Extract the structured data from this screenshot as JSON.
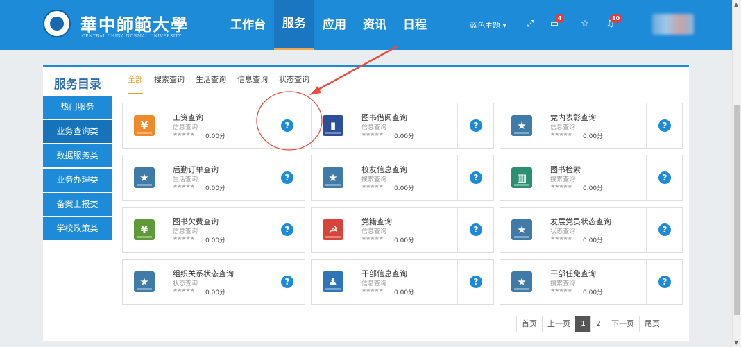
{
  "header": {
    "brand_cn": "華中師範大學",
    "brand_en": "CENTRAL CHINA NORMAL UNIVERSITY",
    "nav": [
      "工作台",
      "服务",
      "应用",
      "资讯",
      "日程"
    ],
    "active_nav": "服务",
    "theme_label": "蓝色主题 ▾",
    "message_badge": "4",
    "notification_badge": "10"
  },
  "panel": {
    "title": "服务目录",
    "tabs": [
      "全部",
      "搜索查询",
      "生活查询",
      "信息查询",
      "状态查询"
    ],
    "active_tab": "全部"
  },
  "sidebar": {
    "items": [
      "热门服务",
      "业务查询类",
      "数据服务类",
      "业务办理类",
      "备案上报类",
      "学校政策类"
    ],
    "active": "业务查询类"
  },
  "cards": [
    {
      "name": "工资查询",
      "category": "信息查询",
      "score": "0.00分",
      "icon": "salary-icon",
      "color": "#ee8a2a",
      "glyph": "¥"
    },
    {
      "name": "图书借阅查询",
      "category": "信息查询",
      "score": "0.00分",
      "icon": "book-icon",
      "color": "#2d4f9a",
      "glyph": "▮"
    },
    {
      "name": "党内表彰查询",
      "category": "信息查询",
      "score": "0.00分",
      "icon": "award-icon",
      "color": "#3f7ba6",
      "glyph": "★"
    },
    {
      "name": "后勤订单查询",
      "category": "生活查询",
      "score": "0.00分",
      "icon": "award-icon",
      "color": "#3f7ba6",
      "glyph": "★"
    },
    {
      "name": "校友信息查询",
      "category": "搜索查询",
      "score": "0.00分",
      "icon": "award-icon",
      "color": "#3f7ba6",
      "glyph": "★"
    },
    {
      "name": "图书检索",
      "category": "搜索查询",
      "score": "0.00分",
      "icon": "open-book-icon",
      "color": "#2b8f74",
      "glyph": "▥"
    },
    {
      "name": "图书欠费查询",
      "category": "信息查询",
      "score": "0.00分",
      "icon": "fee-icon",
      "color": "#5e9a3a",
      "glyph": "¥"
    },
    {
      "name": "党籍查询",
      "category": "信息查询",
      "score": "0.00分",
      "icon": "party-icon",
      "color": "#d8443a",
      "glyph": "☭"
    },
    {
      "name": "发展党员状态查询",
      "category": "状态查询",
      "score": "0.00分",
      "icon": "award-icon",
      "color": "#3f7ba6",
      "glyph": "★"
    },
    {
      "name": "组织关系状态查询",
      "category": "状态查询",
      "score": "0.00分",
      "icon": "award-icon",
      "color": "#3f7ba6",
      "glyph": "★"
    },
    {
      "name": "干部信息查询",
      "category": "信息查询",
      "score": "0.00分",
      "icon": "team-icon",
      "color": "#2f74b5",
      "glyph": "♟"
    },
    {
      "name": "干部任免查询",
      "category": "搜索查询",
      "score": "0.00分",
      "icon": "award-icon",
      "color": "#3f7ba6",
      "glyph": "★"
    }
  ],
  "stars_text": "★★★★★",
  "qmark": "?",
  "pager": {
    "first": "首页",
    "prev": "上一页",
    "pages": [
      "1",
      "2"
    ],
    "current": "1",
    "next": "下一页",
    "last": "尾页"
  }
}
